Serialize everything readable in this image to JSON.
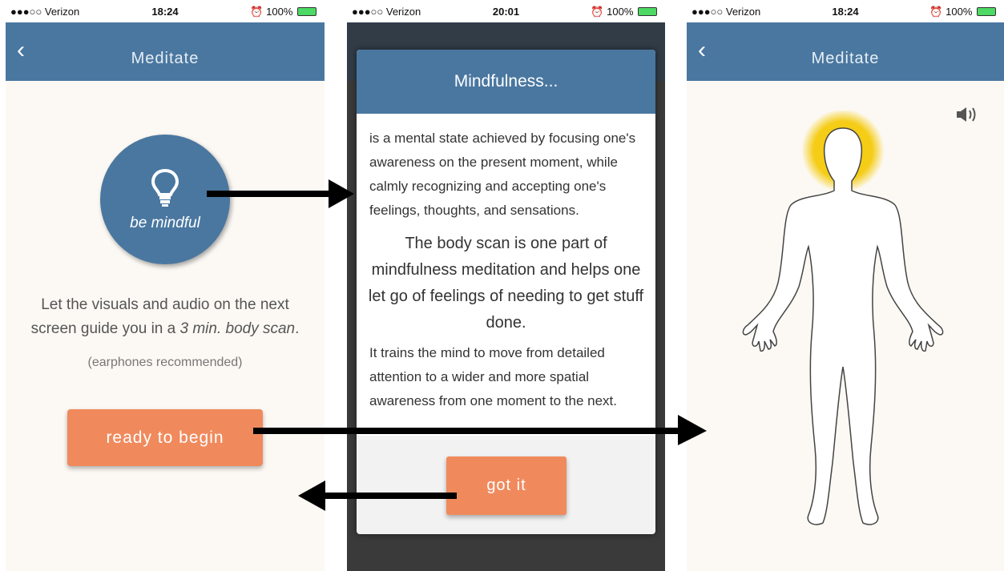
{
  "screens": [
    {
      "status": {
        "carrier": "●●●○○ Verizon",
        "time": "18:24",
        "right": "100%"
      },
      "nav": {
        "back": "‹",
        "title": "Meditate"
      },
      "circle_label": "be mindful",
      "guide_line1": "Let the visuals and audio on the next",
      "guide_line2_prefix": "screen guide you in a ",
      "guide_line2_italic": "3 min. body scan",
      "guide_line2_suffix": ".",
      "earphones": "(earphones recommended)",
      "begin_button": "ready to begin"
    },
    {
      "status": {
        "carrier": "●●●○○ Verizon",
        "time": "20:01",
        "right": "100%"
      },
      "modal": {
        "title": "Mindfulness...",
        "para1": "is a mental state achieved by focusing one's awareness on the present moment, while calmly recognizing and accepting one's feelings, thoughts, and sensations.",
        "para2": "The body scan is one part of mindfulness meditation and helps one let go of feelings of needing to get stuff done.",
        "para3": "It trains the mind to move from detailed attention to a wider and more spatial awareness from one moment to the next.",
        "button": "got it"
      }
    },
    {
      "status": {
        "carrier": "●●●○○ Verizon",
        "time": "18:24",
        "right": "100%"
      },
      "nav": {
        "back": "‹",
        "title": "Meditate"
      },
      "icons": {
        "sound": "speaker-icon",
        "figure": "body-outline-icon"
      },
      "highlight_color": "#f5cc16"
    }
  ],
  "colors": {
    "primary": "#4a77a0",
    "accent": "#f08a5d",
    "background": "#fcf9f4"
  }
}
